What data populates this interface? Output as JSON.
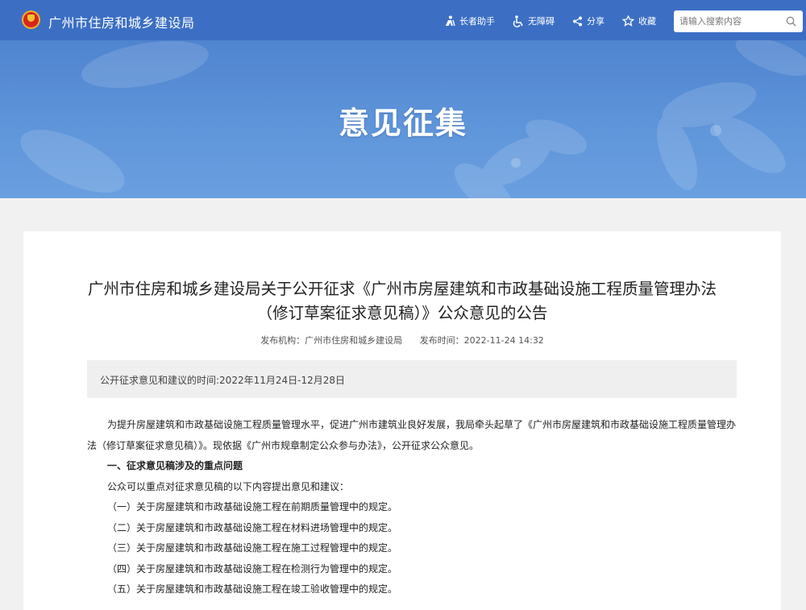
{
  "header": {
    "site_title": "广州市住房和城乡建设局",
    "tools": {
      "elderly": "长者助手",
      "accessibility": "无障碍",
      "share": "分享",
      "favorite": "收藏"
    },
    "search": {
      "placeholder": "请输入搜索内容",
      "icon": "search-icon"
    }
  },
  "banner": {
    "title": "意见征集"
  },
  "article": {
    "title_line1": "广州市住房和城乡建设局关于公开征求《广州市房屋建筑和市政基础设施工程质量管理办法",
    "title_line2": "（修订草案征求意见稿）》公众意见的公告",
    "publisher": "发布机构：广州市住房和城乡建设局",
    "published_time": "发布时间：2022-11-24 14:32",
    "period": "公开征求意见和建议的时间:2022年11月24日-12月28日",
    "intro": "为提升房屋建筑和市政基础设施工程质量管理水平，促进广州市建筑业良好发展，我局牵头起草了《广州市房屋建筑和市政基础设施工程质量管理办法（修订草案征求意见稿）》。现依据《广州市规章制定公众参与办法》，公开征求公众意见。",
    "section1_heading": "一、征求意见稿涉及的重点问题",
    "section1_lead": "公众可以重点对征求意见稿的以下内容提出意见和建议：",
    "items": [
      "（一）关于房屋建筑和市政基础设施工程在前期质量管理中的规定。",
      "（二）关于房屋建筑和市政基础设施工程在材料进场管理中的规定。",
      "（三）关于房屋建筑和市政基础设施工程在施工过程管理中的规定。",
      "（四）关于房屋建筑和市政基础设施工程在检测行为管理中的规定。",
      "（五）关于房屋建筑和市政基础设施工程在竣工验收管理中的规定。"
    ]
  },
  "colors": {
    "header_blue": "#3c6fc4",
    "banner_blue": "#5f95da",
    "page_bg": "#f1f1f1"
  }
}
